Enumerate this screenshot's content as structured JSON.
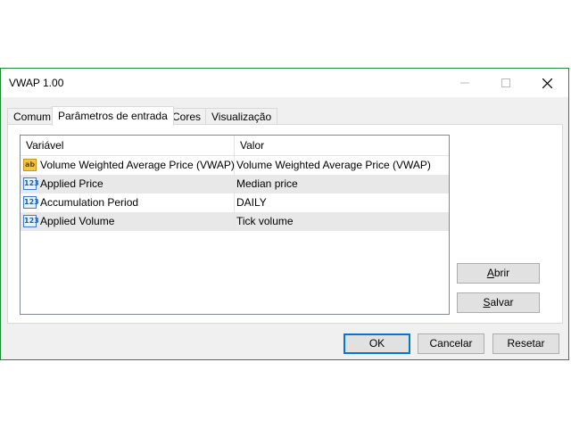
{
  "window": {
    "title": "VWAP 1.00",
    "controls": {
      "minimize_icon": "minimize-icon",
      "maximize_icon": "maximize-icon",
      "close_icon": "close-icon"
    }
  },
  "tabs": [
    {
      "label": "Comum",
      "active": false
    },
    {
      "label": "Parâmetros de entrada",
      "active": true
    },
    {
      "label": "Cores",
      "active": false
    },
    {
      "label": "Visualização",
      "active": false
    }
  ],
  "grid": {
    "columns": [
      "Variável",
      "Valor"
    ],
    "rows": [
      {
        "icon": "ab",
        "icon_text": "ab",
        "variable": "Volume Weighted Average Price (VWAP)",
        "value": "Volume Weighted Average Price (VWAP)"
      },
      {
        "icon": "num",
        "icon_text": "123",
        "variable": "Applied Price",
        "value": "Median price"
      },
      {
        "icon": "num",
        "icon_text": "123",
        "variable": "Accumulation Period",
        "value": "DAILY"
      },
      {
        "icon": "num",
        "icon_text": "123",
        "variable": "Applied Volume",
        "value": "Tick volume"
      }
    ]
  },
  "side_buttons": {
    "open": "Abrir",
    "save": "Salvar"
  },
  "footer_buttons": {
    "ok": "OK",
    "cancel": "Cancelar",
    "reset": "Resetar"
  },
  "colors": {
    "window_border": "#1e8a3a",
    "default_button_border": "#0078d7",
    "alt_row": "#e8e8e8"
  }
}
